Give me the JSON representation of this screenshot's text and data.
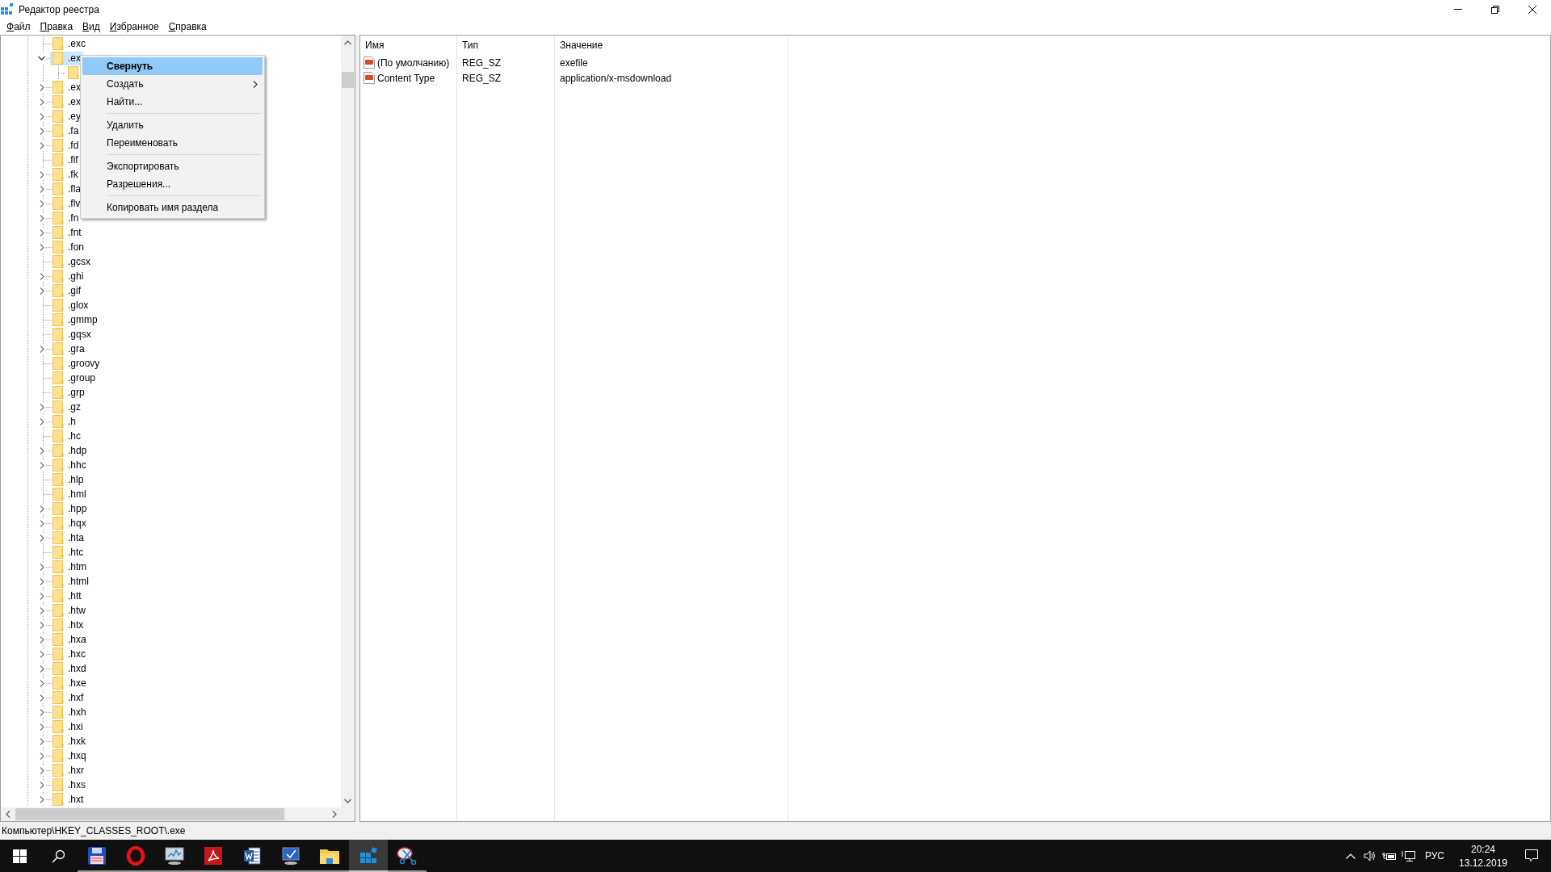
{
  "window": {
    "title": "Редактор реестра"
  },
  "menu_bar": [
    {
      "label": "Файл"
    },
    {
      "label": "Правка"
    },
    {
      "label": "Вид"
    },
    {
      "label": "Избранное"
    },
    {
      "label": "Справка"
    }
  ],
  "tree": {
    "items": [
      {
        "label": ".exc",
        "expandable": false,
        "selected": false
      },
      {
        "label": ".ex",
        "expandable": true,
        "expanded": true,
        "selected": true,
        "children": [
          {
            "expandable": false,
            "selected": false
          }
        ]
      },
      {
        "label": ".ex",
        "expandable": true,
        "expanded": false,
        "selected": false
      },
      {
        "label": ".ex",
        "expandable": true,
        "expanded": false,
        "selected": false
      },
      {
        "label": ".ey",
        "expandable": true,
        "expanded": false,
        "selected": false
      },
      {
        "label": ".fa",
        "expandable": true,
        "expanded": false,
        "selected": false
      },
      {
        "label": ".fd",
        "expandable": true,
        "expanded": false,
        "selected": false
      },
      {
        "label": ".fif",
        "expandable": false,
        "selected": false
      },
      {
        "label": ".fk",
        "expandable": true,
        "expanded": false,
        "selected": false
      },
      {
        "label": ".fla",
        "expandable": true,
        "expanded": false,
        "selected": false
      },
      {
        "label": ".flv",
        "expandable": true,
        "expanded": false,
        "selected": false
      },
      {
        "label": ".fn",
        "expandable": true,
        "expanded": false,
        "selected": false
      },
      {
        "label": ".fnt",
        "expandable": true,
        "expanded": false,
        "selected": false
      },
      {
        "label": ".fon",
        "expandable": true,
        "expanded": false,
        "selected": false
      },
      {
        "label": ".gcsx",
        "expandable": false,
        "selected": false
      },
      {
        "label": ".ghi",
        "expandable": true,
        "expanded": false,
        "selected": false
      },
      {
        "label": ".gif",
        "expandable": true,
        "expanded": false,
        "selected": false
      },
      {
        "label": ".glox",
        "expandable": false,
        "selected": false
      },
      {
        "label": ".gmmp",
        "expandable": false,
        "selected": false
      },
      {
        "label": ".gqsx",
        "expandable": false,
        "selected": false
      },
      {
        "label": ".gra",
        "expandable": true,
        "expanded": false,
        "selected": false
      },
      {
        "label": ".groovy",
        "expandable": false,
        "selected": false
      },
      {
        "label": ".group",
        "expandable": false,
        "selected": false
      },
      {
        "label": ".grp",
        "expandable": false,
        "selected": false
      },
      {
        "label": ".gz",
        "expandable": true,
        "expanded": false,
        "selected": false
      },
      {
        "label": ".h",
        "expandable": true,
        "expanded": false,
        "selected": false
      },
      {
        "label": ".hc",
        "expandable": false,
        "selected": false
      },
      {
        "label": ".hdp",
        "expandable": true,
        "expanded": false,
        "selected": false
      },
      {
        "label": ".hhc",
        "expandable": true,
        "expanded": false,
        "selected": false
      },
      {
        "label": ".hlp",
        "expandable": false,
        "selected": false
      },
      {
        "label": ".hml",
        "expandable": false,
        "selected": false
      },
      {
        "label": ".hpp",
        "expandable": true,
        "expanded": false,
        "selected": false
      },
      {
        "label": ".hqx",
        "expandable": true,
        "expanded": false,
        "selected": false
      },
      {
        "label": ".hta",
        "expandable": true,
        "expanded": false,
        "selected": false
      },
      {
        "label": ".htc",
        "expandable": false,
        "selected": false
      },
      {
        "label": ".htm",
        "expandable": true,
        "expanded": false,
        "selected": false
      },
      {
        "label": ".html",
        "expandable": true,
        "expanded": false,
        "selected": false
      },
      {
        "label": ".htt",
        "expandable": true,
        "expanded": false,
        "selected": false
      },
      {
        "label": ".htw",
        "expandable": true,
        "expanded": false,
        "selected": false
      },
      {
        "label": ".htx",
        "expandable": true,
        "expanded": false,
        "selected": false
      },
      {
        "label": ".hxa",
        "expandable": true,
        "expanded": false,
        "selected": false
      },
      {
        "label": ".hxc",
        "expandable": true,
        "expanded": false,
        "selected": false
      },
      {
        "label": ".hxd",
        "expandable": true,
        "expanded": false,
        "selected": false
      },
      {
        "label": ".hxe",
        "expandable": true,
        "expanded": false,
        "selected": false
      },
      {
        "label": ".hxf",
        "expandable": true,
        "expanded": false,
        "selected": false
      },
      {
        "label": ".hxh",
        "expandable": true,
        "expanded": false,
        "selected": false
      },
      {
        "label": ".hxi",
        "expandable": true,
        "expanded": false,
        "selected": false
      },
      {
        "label": ".hxk",
        "expandable": true,
        "expanded": false,
        "selected": false
      },
      {
        "label": ".hxq",
        "expandable": true,
        "expanded": false,
        "selected": false
      },
      {
        "label": ".hxr",
        "expandable": true,
        "expanded": false,
        "selected": false
      },
      {
        "label": ".hxs",
        "expandable": true,
        "expanded": false,
        "selected": false
      },
      {
        "label": ".hxt",
        "expandable": true,
        "expanded": false,
        "selected": false
      }
    ]
  },
  "context_menu": {
    "items": [
      {
        "kind": "item",
        "label": "Свернуть",
        "default": true,
        "submenu": false,
        "selected": true
      },
      {
        "kind": "item",
        "label": "Создать",
        "default": false,
        "submenu": true,
        "selected": false
      },
      {
        "kind": "item",
        "label": "Найти...",
        "default": false,
        "submenu": false,
        "selected": false
      },
      {
        "kind": "separator"
      },
      {
        "kind": "item",
        "label": "Удалить",
        "default": false,
        "submenu": false,
        "selected": false
      },
      {
        "kind": "item",
        "label": "Переименовать",
        "default": false,
        "submenu": false,
        "selected": false
      },
      {
        "kind": "separator"
      },
      {
        "kind": "item",
        "label": "Экспортировать",
        "default": false,
        "submenu": false,
        "selected": false
      },
      {
        "kind": "item",
        "label": "Разрешения...",
        "default": false,
        "submenu": false,
        "selected": false
      },
      {
        "kind": "separator"
      },
      {
        "kind": "item",
        "label": "Копировать имя раздела",
        "default": false,
        "submenu": false,
        "selected": false
      }
    ]
  },
  "values": {
    "columns": [
      "Имя",
      "Тип",
      "Значение"
    ],
    "rows": [
      {
        "name": "(По умолчанию)",
        "type": "REG_SZ",
        "data": "exefile"
      },
      {
        "name": "Content Type",
        "type": "REG_SZ",
        "data": "application/x-msdownload"
      }
    ]
  },
  "status_bar": {
    "path": "Компьютер\\HKEY_CLASSES_ROOT\\.exe"
  },
  "taskbar": {
    "apps": [
      {
        "kind": "floppy",
        "running": true,
        "selected": false
      },
      {
        "kind": "ring",
        "running": true,
        "selected": false
      },
      {
        "kind": "monitor-chart",
        "running": true,
        "selected": false
      },
      {
        "kind": "pdf",
        "running": true,
        "selected": false
      },
      {
        "kind": "document",
        "running": true,
        "selected": false
      },
      {
        "kind": "monitor",
        "running": true,
        "selected": false
      },
      {
        "kind": "folder",
        "running": true,
        "selected": false
      },
      {
        "kind": "cubes",
        "running": true,
        "selected": true
      },
      {
        "kind": "scissors",
        "running": true,
        "selected": false
      }
    ],
    "tray": {
      "language": "РУС",
      "time": "20:24",
      "date": "13.12.2019"
    }
  }
}
